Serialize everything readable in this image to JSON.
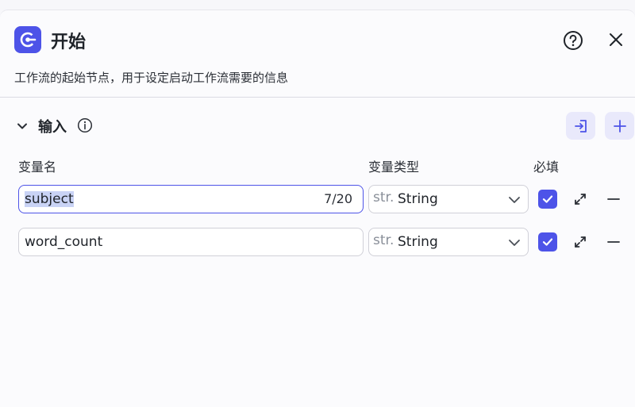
{
  "header": {
    "title": "开始",
    "description": "工作流的起始节点，用于设定启动工作流需要的信息"
  },
  "inputs_section": {
    "title": "输入",
    "columns": {
      "name": "变量名",
      "type": "变量类型",
      "required": "必填"
    },
    "rows": [
      {
        "name": "subject",
        "counter": "7/20",
        "type_prefix": "str.",
        "type": "String",
        "required": true
      },
      {
        "name": "word_count",
        "type_prefix": "str.",
        "type": "String",
        "required": true
      }
    ]
  },
  "colors": {
    "accent": "#4d53e8",
    "accent_light": "#e9e9fb",
    "text_selection": "#c9d3f5"
  },
  "icons": {
    "app": "start-node-icon",
    "help": "question-circle-icon",
    "close": "close-icon",
    "toggle": "chevron-down-icon",
    "info": "info-circle-icon",
    "import": "import-icon",
    "add": "plus-icon",
    "expand": "expand-arrows-icon",
    "remove": "minus-icon"
  }
}
